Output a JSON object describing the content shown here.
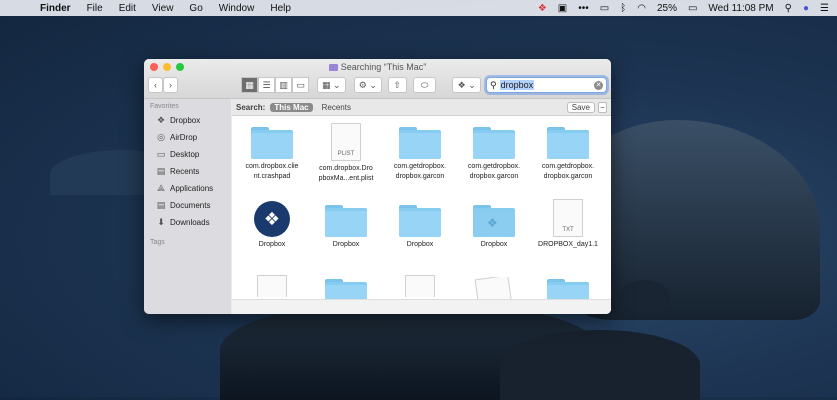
{
  "menubar": {
    "app": "Finder",
    "items": [
      "File",
      "Edit",
      "View",
      "Go",
      "Window",
      "Help"
    ],
    "battery": "25%",
    "datetime": "Wed 11:08 PM"
  },
  "window": {
    "title": "Searching “This Mac”",
    "search_query": "dropbox"
  },
  "sidebar": {
    "favorites_header": "Favorites",
    "items": [
      {
        "label": "Dropbox",
        "icon": "dropbox-icon"
      },
      {
        "label": "AirDrop",
        "icon": "airdrop-icon"
      },
      {
        "label": "Desktop",
        "icon": "desktop-icon"
      },
      {
        "label": "Recents",
        "icon": "recents-icon"
      },
      {
        "label": "Applications",
        "icon": "applications-icon"
      },
      {
        "label": "Documents",
        "icon": "documents-icon"
      },
      {
        "label": "Downloads",
        "icon": "downloads-icon"
      }
    ],
    "tags_header": "Tags"
  },
  "searchbar": {
    "label": "Search:",
    "scope_selected": "This Mac",
    "scope_other": "Recents",
    "save": "Save",
    "minus": "−"
  },
  "results": [
    {
      "name1": "com.dropbox.clie",
      "name2": "nt.crashpad",
      "kind": "folder"
    },
    {
      "name1": "com.dropbox.Dro",
      "name2": "pboxMa...ent.plist",
      "kind": "plist",
      "badge": "PLIST"
    },
    {
      "name1": "com.getdropbox.",
      "name2": "dropbox.garcon",
      "kind": "folder"
    },
    {
      "name1": "com.getdropbox.",
      "name2": "dropbox.garcon",
      "kind": "folder"
    },
    {
      "name1": "com.getdropbox.",
      "name2": "dropbox.garcon",
      "kind": "folder"
    },
    {
      "name1": "Dropbox",
      "name2": "",
      "kind": "app"
    },
    {
      "name1": "Dropbox",
      "name2": "",
      "kind": "folder"
    },
    {
      "name1": "Dropbox",
      "name2": "",
      "kind": "folder"
    },
    {
      "name1": "Dropbox",
      "name2": "",
      "kind": "dropbox-folder"
    },
    {
      "name1": "DROPBOX_day1.1",
      "name2": "",
      "kind": "txt",
      "badge": "TXT"
    }
  ]
}
